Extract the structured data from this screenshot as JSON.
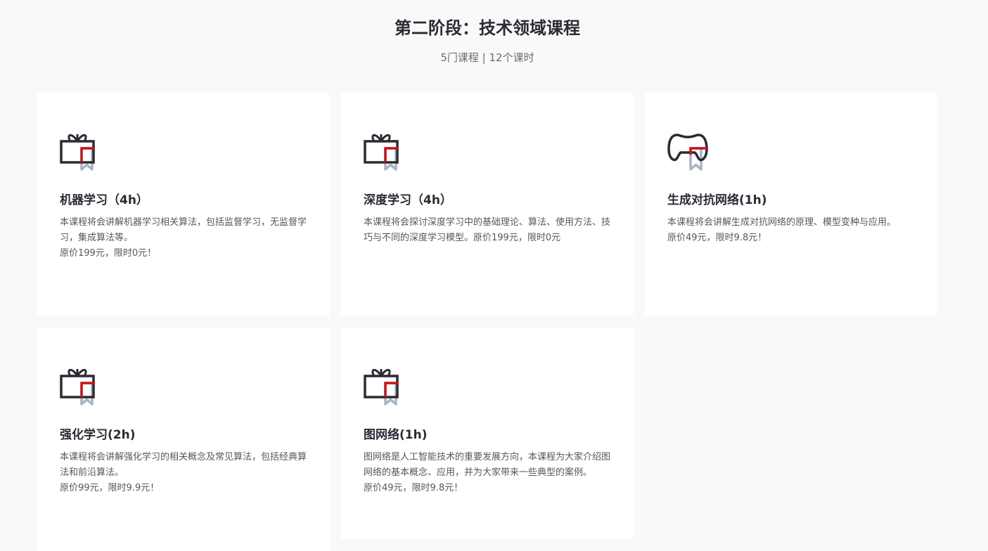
{
  "header": {
    "title": "第二阶段：技术领域课程",
    "subtitle": "5门课程 | 12个课时"
  },
  "colors": {
    "background": "#f9f9f9",
    "card": "#ffffff",
    "icon_dark": "#2a2b34",
    "icon_red": "#c3161c",
    "icon_gray": "#a9b5c2"
  },
  "courses": [
    {
      "icon": "gift-bookmark-icon",
      "title": "机器学习（4h）",
      "desc": "本课程将会讲解机器学习相关算法，包括监督学习，无监督学习，集成算法等。",
      "price": "原价199元，限时0元！"
    },
    {
      "icon": "gift-bookmark-icon",
      "title": "深度学习（4h）",
      "desc": "本课程将会探讨深度学习中的基础理论、算法、使用方法、技巧与不同的深度学习模型。原价199元，限时0元",
      "price": ""
    },
    {
      "icon": "gamepad-bookmark-icon",
      "title": "生成对抗网络(1h)",
      "desc": "本课程将会讲解生成对抗网络的原理、模型变种与应用。",
      "price": "原价49元，限时9.8元！"
    },
    {
      "icon": "gift-bookmark-icon",
      "title": "强化学习(2h)",
      "desc": "本课程将会讲解强化学习的相关概念及常见算法，包括经典算法和前沿算法。",
      "price": "原价99元，限时9.9元！"
    },
    {
      "icon": "gift-bookmark-icon",
      "title": "图网络(1h)",
      "desc": "图网络是人工智能技术的重要发展方向，本课程为大家介绍图网络的基本概念、应用，并为大家带来一些典型的案例。",
      "price": "原价49元，限时9.8元！"
    }
  ]
}
